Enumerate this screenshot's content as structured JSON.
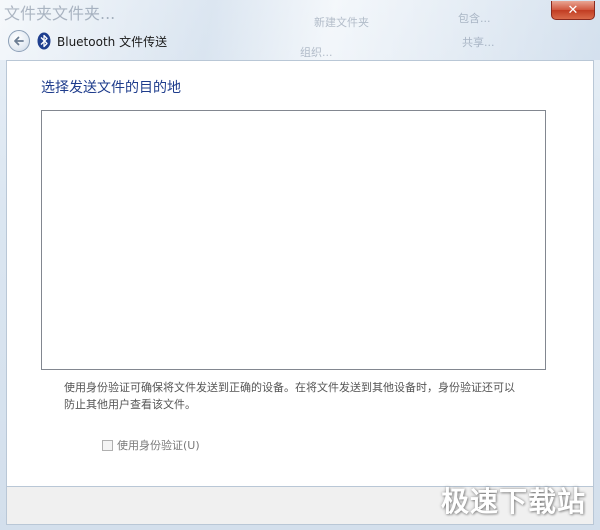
{
  "window": {
    "title": "Bluetooth 文件传送",
    "close_glyph": "✕",
    "back_glyph": "←"
  },
  "background": {
    "blurred_title": "文件夹文件夹...",
    "blurred_items": [
      "新建文件夹",
      "包含...",
      "共享...",
      "组织..."
    ]
  },
  "main": {
    "heading": "选择发送文件的目的地",
    "devices": [],
    "description_line1": "使用身份验证可确保将文件发送到正确的设备。在将文件发送到其他设备时，身份验证还可以",
    "description_line2": "防止其他用户查看该文件。",
    "auth_checkbox": {
      "label": "使用身份验证(U)",
      "checked": false,
      "enabled": false
    }
  },
  "watermark": "极速下载站",
  "colors": {
    "heading": "#1e3c8c",
    "close_button": "#c13c22",
    "footer": "#f0f0f0"
  }
}
